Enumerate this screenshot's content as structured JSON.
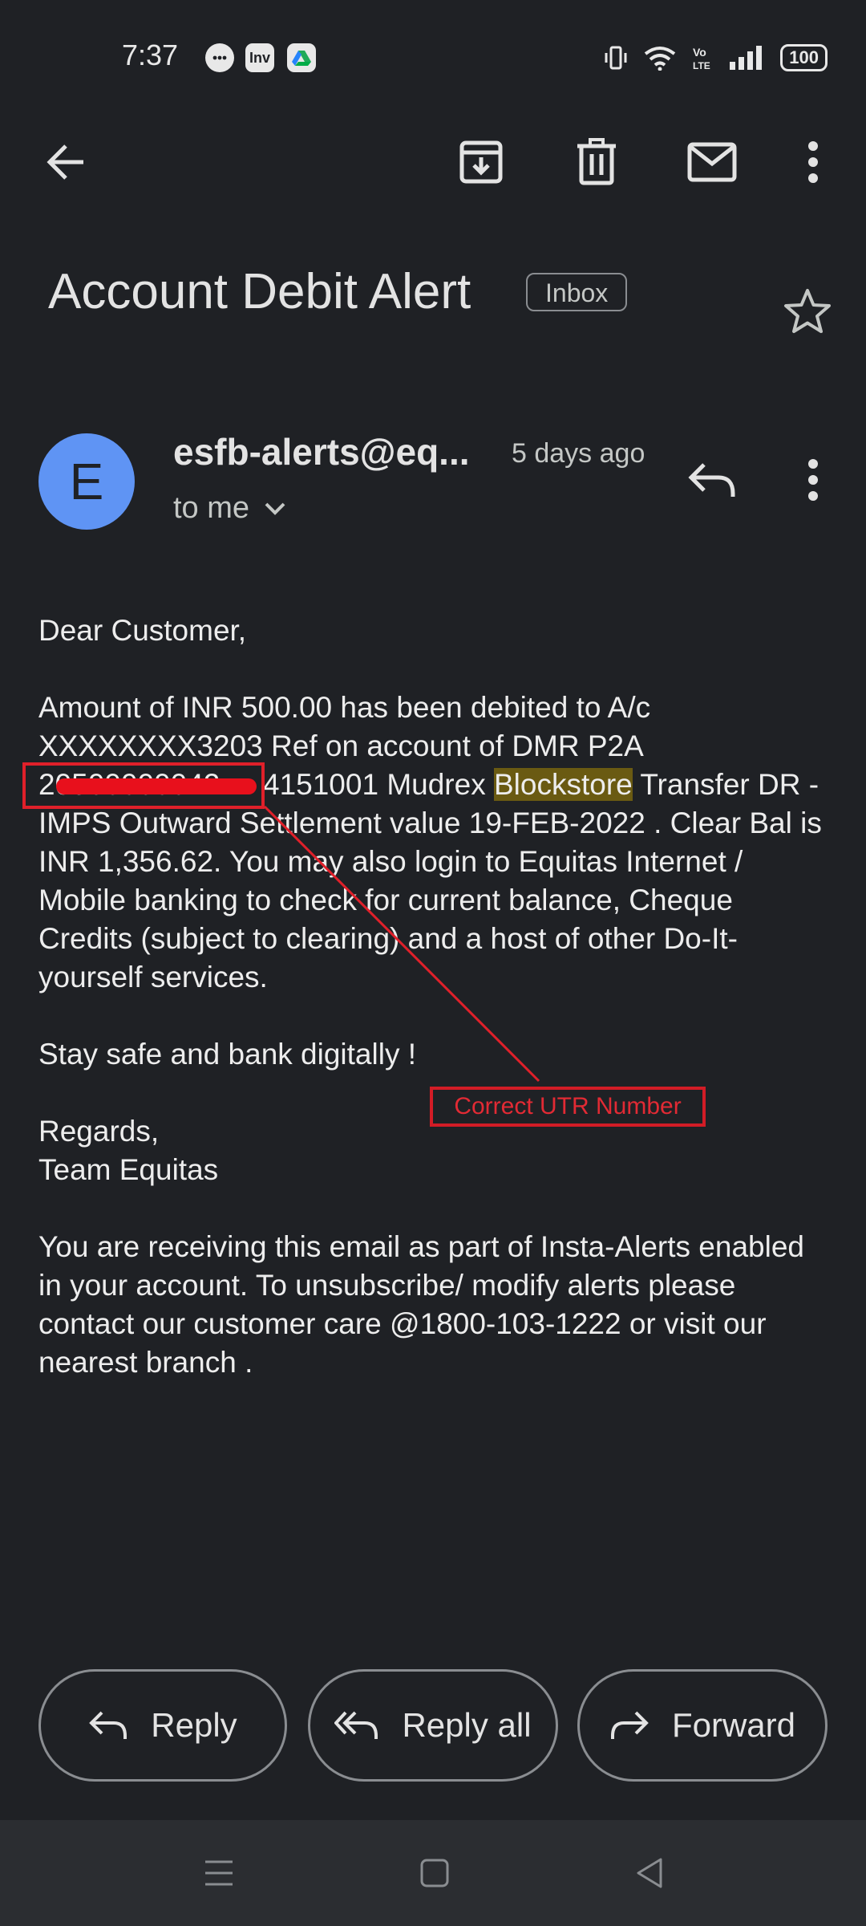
{
  "status_bar": {
    "time": "7:37",
    "notif_icons": [
      "chat-bubble-icon",
      "inv-app-icon",
      "drive-icon"
    ],
    "inv_label": "Inv",
    "battery": "100"
  },
  "toolbar": {
    "icons": [
      "back-arrow-icon",
      "archive-icon",
      "delete-icon",
      "mark-unread-icon",
      "more-vert-icon"
    ]
  },
  "email": {
    "subject": "Account Debit Alert",
    "label": "Inbox",
    "avatar_letter": "E",
    "sender": "esfb-alerts@eq...",
    "time_ago": "5 days ago",
    "recipient": "to me",
    "body": {
      "greeting": "Dear Customer,",
      "para1_a": "Amount of INR 500.00 has been debited to A/c XXXXXXXX3203 Ref   on account of DMR P2A ",
      "para1_utr": "20500000042",
      "para1_b": "4151001 Mudrex ",
      "para1_highlight": "Blockstore",
      "para1_c": " Transfer DR - IMPS Outward Settlement value 19-FEB-2022 . Clear Bal is INR 1,356.62. You may also login to Equitas Internet / Mobile banking to check for current balance, Cheque Credits (subject to clearing) and a host of other Do-It-yourself services.",
      "para2": "Stay safe and bank digitally !",
      "regards": "Regards,",
      "team": "Team Equitas",
      "para3": "You are receiving this email as part of Insta-Alerts enabled in your account. To unsubscribe/ modify alerts please contact our customer care @1800-103-1222 or visit our nearest branch ."
    }
  },
  "annotation": {
    "label": "Correct UTR Number",
    "color": "#e0202a"
  },
  "actions": {
    "reply": "Reply",
    "reply_all": "Reply all",
    "forward": "Forward"
  },
  "nav": {
    "icons": [
      "menu-icon",
      "home-square-icon",
      "back-triangle-icon"
    ]
  }
}
